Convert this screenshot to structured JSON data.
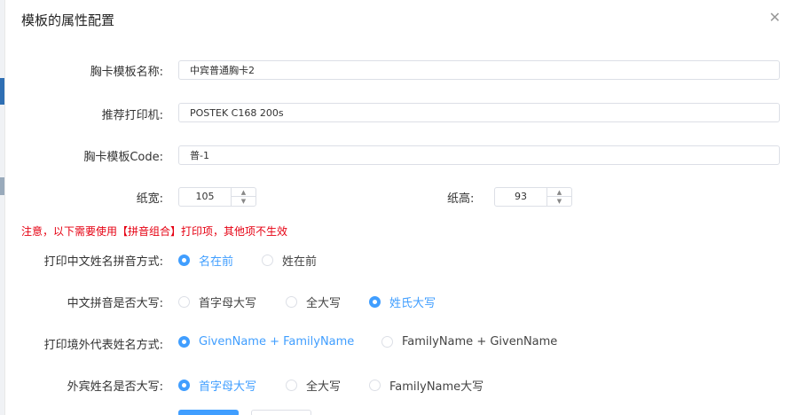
{
  "dialog": {
    "title": "模板的属性配置"
  },
  "fields": {
    "template_name": {
      "label": "胸卡模板名称:",
      "value": "中宾普通胸卡2"
    },
    "printer": {
      "label": "推荐打印机:",
      "value": "POSTEK C168 200s"
    },
    "code": {
      "label": "胸卡模板Code:",
      "value": "普-1"
    },
    "width": {
      "label": "纸宽:",
      "value": "105"
    },
    "height": {
      "label": "纸高:",
      "value": "93"
    }
  },
  "notice": "注意，以下需要使用【拼音组合】打印项，其他项不生效",
  "radio_groups": [
    {
      "label": "打印中文姓名拼音方式:",
      "options": [
        {
          "text": "名在前",
          "selected": true
        },
        {
          "text": "姓在前",
          "selected": false
        }
      ]
    },
    {
      "label": "中文拼音是否大写:",
      "options": [
        {
          "text": "首字母大写",
          "selected": false
        },
        {
          "text": "全大写",
          "selected": false
        },
        {
          "text": "姓氏大写",
          "selected": true
        }
      ]
    },
    {
      "label": "打印境外代表姓名方式:",
      "options": [
        {
          "text": "GivenName + FamilyName",
          "selected": true
        },
        {
          "text": "FamilyName + GivenName",
          "selected": false
        }
      ]
    },
    {
      "label": "外宾姓名是否大写:",
      "options": [
        {
          "text": "首字母大写",
          "selected": true
        },
        {
          "text": "全大写",
          "selected": false
        },
        {
          "text": "FamilyName大写",
          "selected": false
        }
      ]
    }
  ],
  "colors": {
    "primary": "#409eff",
    "notice": "#e60012",
    "border": "#dcdfe6"
  }
}
